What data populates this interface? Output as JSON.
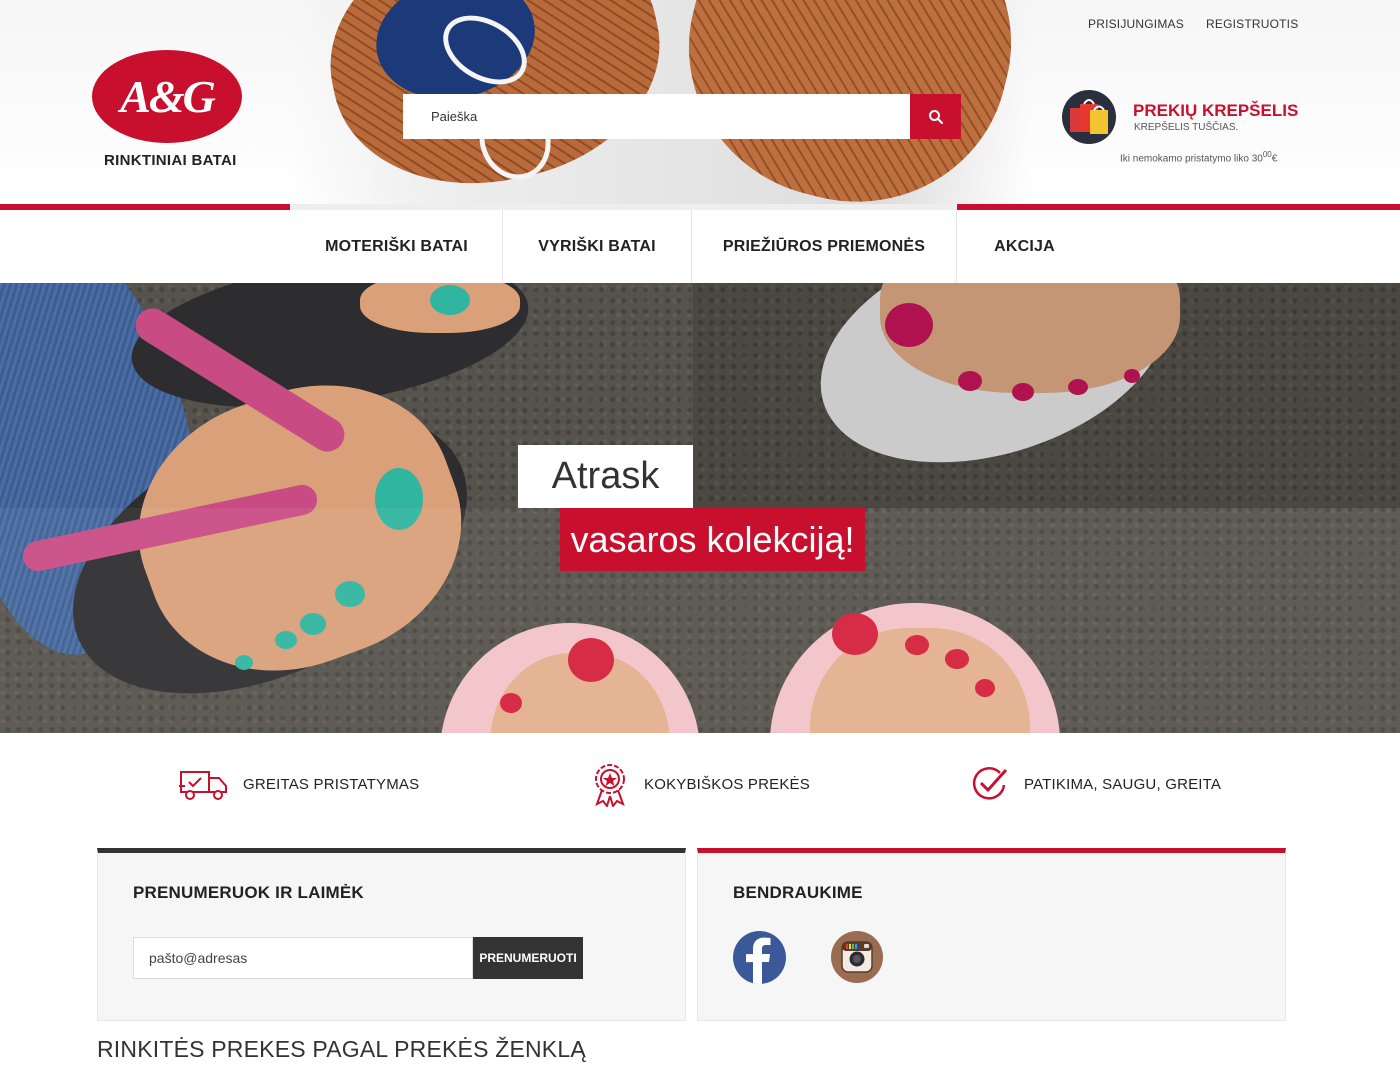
{
  "header": {
    "login_label": "PRISIJUNGIMAS",
    "register_label": "REGISTRUOTIS",
    "logo_text": "A&G",
    "logo_subtitle": "RINKTINIAI BATAI",
    "search_placeholder": "Paieška",
    "cart": {
      "title": "PREKIŲ KREPŠELIS",
      "status": "KREPŠELIS TUŠČIAS.",
      "free_shipping_text": "Iki nemokamo pristatymo liko 30",
      "free_shipping_decimals": "00",
      "currency": "€"
    }
  },
  "nav": {
    "items": [
      {
        "label": "MOTERIŠKI BATAI"
      },
      {
        "label": "VYRIŠKI BATAI"
      },
      {
        "label": "PRIEŽIŪROS PRIEMONĖS"
      },
      {
        "label": "AKCIJA"
      }
    ]
  },
  "hero": {
    "line1": "Atrask",
    "line2": "vasaros kolekciją!"
  },
  "features": [
    {
      "icon": "delivery-truck-icon",
      "label": "GREITAS PRISTATYMAS"
    },
    {
      "icon": "quality-badge-icon",
      "label": "KOKYBIŠKOS PREKĖS"
    },
    {
      "icon": "check-circle-icon",
      "label": "PATIKIMA, SAUGU, GREITA"
    }
  ],
  "subscribe": {
    "title": "PRENUMERUOK IR LAIMĖK",
    "email_placeholder": "pašto@adresas",
    "button_label": "PRENUMERUOTI"
  },
  "social": {
    "title": "BENDRAUKIME",
    "icons": [
      "facebook-icon",
      "instagram-icon"
    ]
  },
  "brands": {
    "title": "RINKITĖS PREKES PAGAL PREKĖS ŽENKLĄ"
  },
  "colors": {
    "brand_red": "#c8102e",
    "dark": "#333333",
    "facebook_blue": "#3b5998"
  }
}
